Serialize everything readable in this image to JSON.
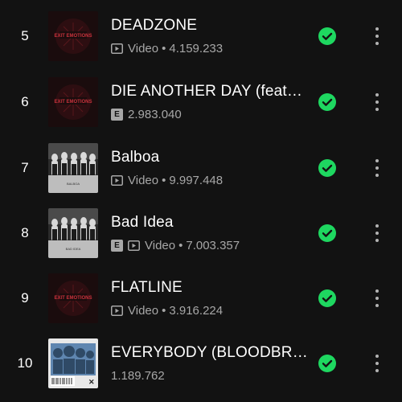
{
  "colors": {
    "background": "#121212",
    "title_text": "#ffffff",
    "meta_text": "#a7a7a7",
    "accent_green": "#1ed760"
  },
  "tracks": [
    {
      "rank": "5",
      "title": "DEADZONE",
      "explicit": false,
      "video": true,
      "video_label": "Video",
      "plays": "4.159.233",
      "art": "exit-emotions-red-logo"
    },
    {
      "rank": "6",
      "title": "DIE ANOTHER DAY (feat…",
      "explicit": true,
      "video": false,
      "video_label": "",
      "plays": "2.983.040",
      "art": "exit-emotions-red-logo"
    },
    {
      "rank": "7",
      "title": "Balboa",
      "explicit": false,
      "video": true,
      "video_label": "Video",
      "plays": "9.997.448",
      "art": "band-photo"
    },
    {
      "rank": "8",
      "title": "Bad Idea",
      "explicit": true,
      "video": true,
      "video_label": "Video",
      "plays": "7.003.357",
      "art": "band-photo"
    },
    {
      "rank": "9",
      "title": "FLATLINE",
      "explicit": false,
      "video": true,
      "video_label": "Video",
      "plays": "3.916.224",
      "art": "exit-emotions-red-logo"
    },
    {
      "rank": "10",
      "title": "EVERYBODY (BLOODBR…",
      "explicit": false,
      "video": false,
      "video_label": "",
      "plays": "1.189.762",
      "art": "collage-blue"
    }
  ],
  "icons": {
    "saved": "check-circle-icon",
    "more": "more-vertical-icon",
    "video": "video-icon",
    "explicit_letter": "E"
  }
}
